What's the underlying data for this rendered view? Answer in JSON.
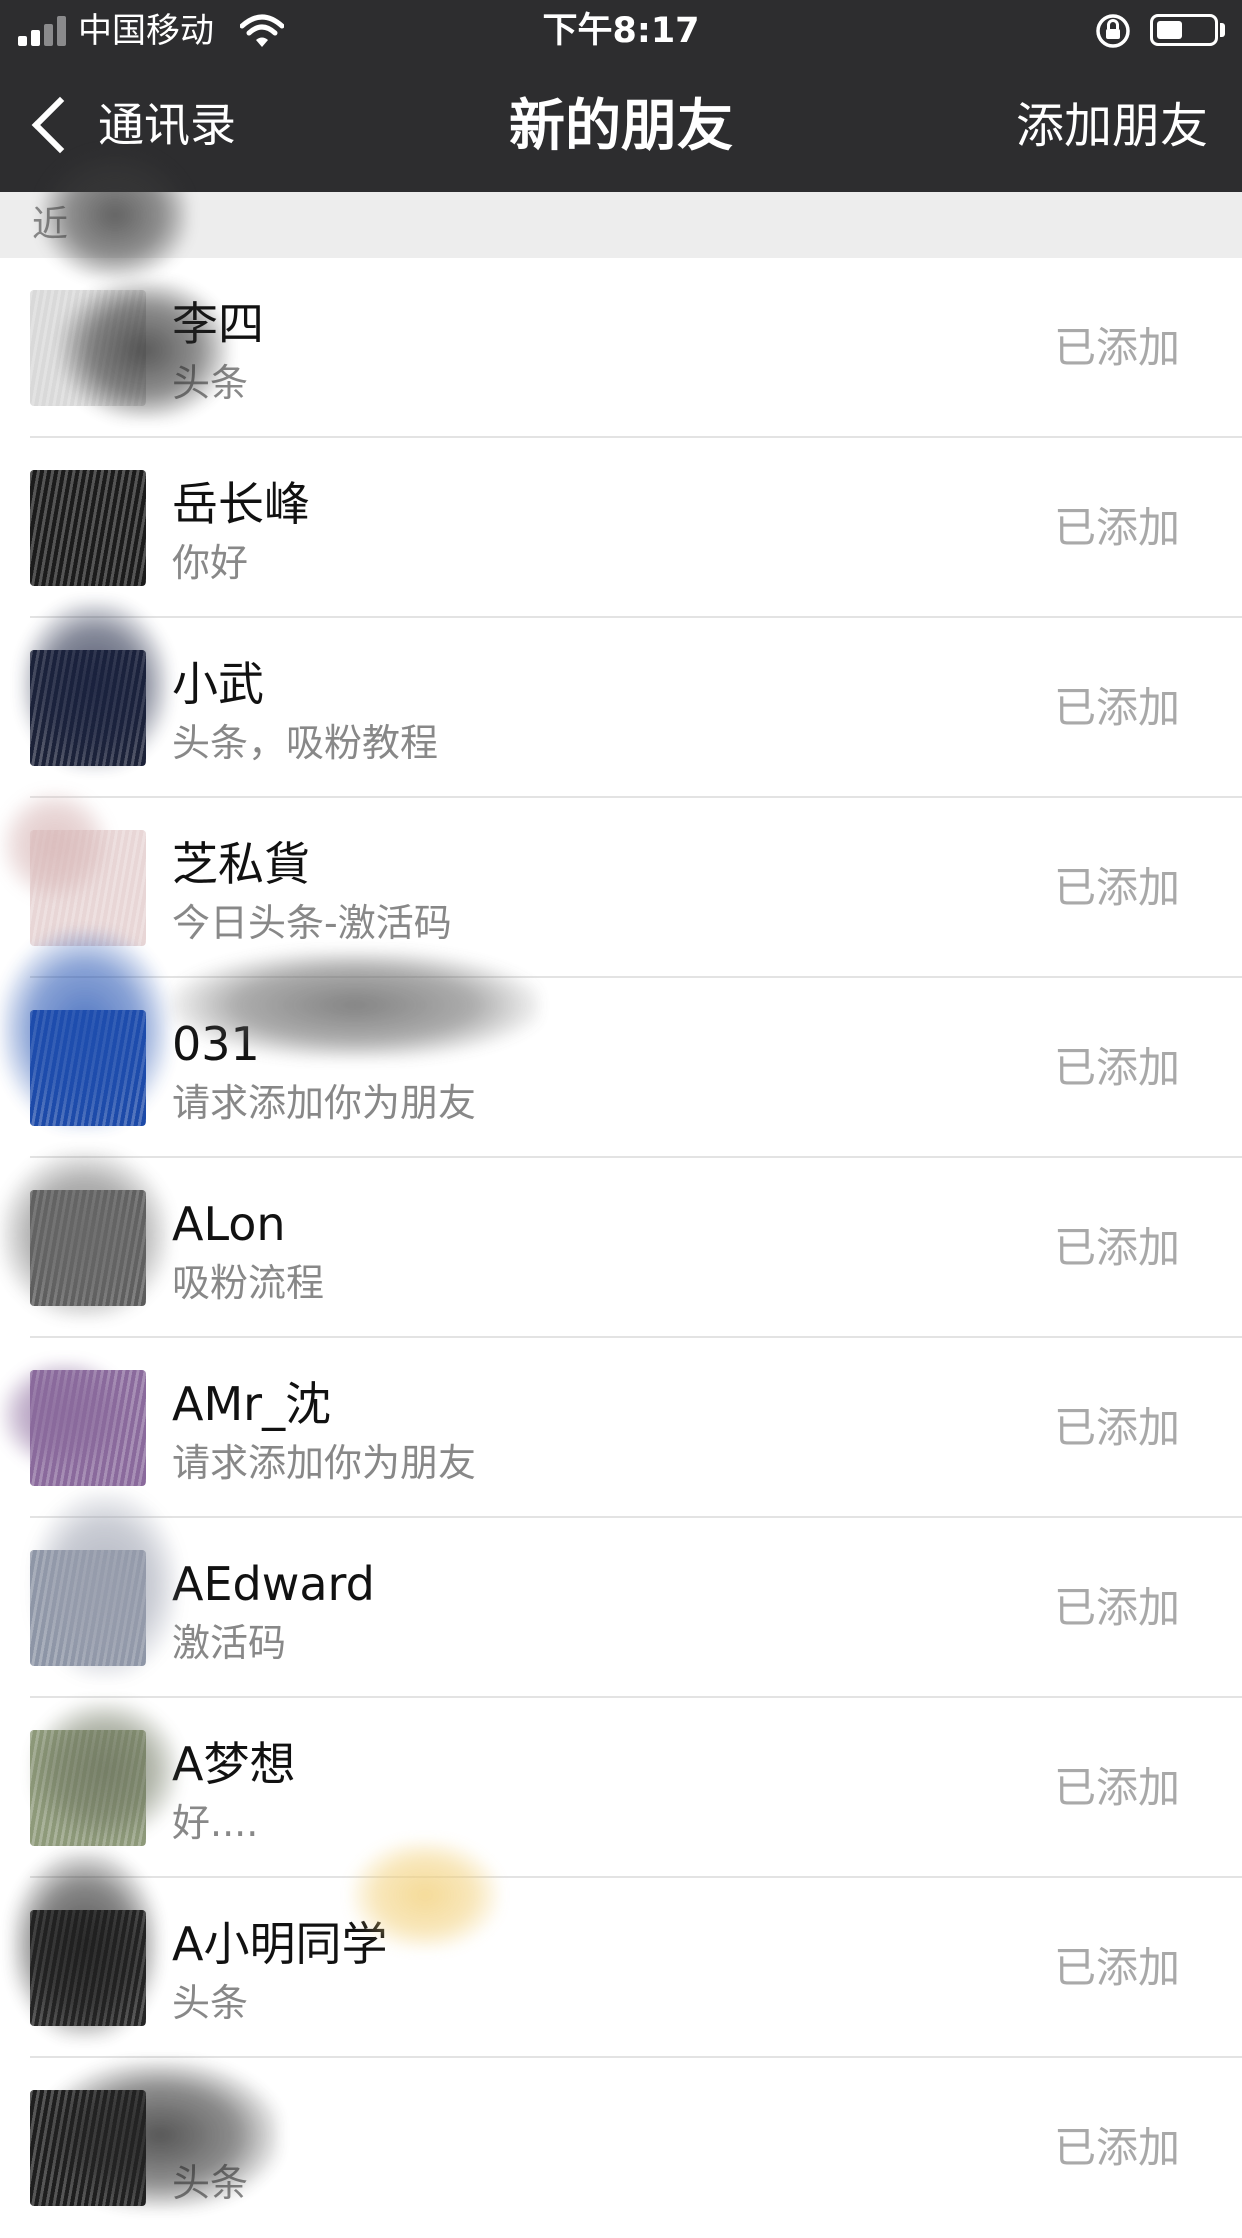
{
  "status_bar": {
    "carrier": "中国移动",
    "time": "下午8:17",
    "battery_level": 0.45
  },
  "nav": {
    "back_label": "通讯录",
    "title": "新的朋友",
    "action_label": "添加朋友"
  },
  "section": {
    "label": "近"
  },
  "requests": [
    {
      "name": "李四",
      "message": "头条",
      "status": "已添加",
      "avatar_color": "#d9d9d9"
    },
    {
      "name": "岳长峰",
      "message": "你好",
      "status": "已添加",
      "avatar_color": "#1b1b1b"
    },
    {
      "name": "小武",
      "message": "头条，吸粉教程",
      "status": "已添加",
      "avatar_color": "#1c2238"
    },
    {
      "name": "芝私貨",
      "message": "今日头条-激活码",
      "status": "已添加",
      "avatar_color": "#e8d6d6"
    },
    {
      "name": "031",
      "message": "请求添加你为朋友",
      "status": "已添加",
      "avatar_color": "#1d4aa8"
    },
    {
      "name": "ALon",
      "message": "吸粉流程",
      "status": "已添加",
      "avatar_color": "#5b5b5b"
    },
    {
      "name": "AMr_沈",
      "message": "请求添加你为朋友",
      "status": "已添加",
      "avatar_color": "#8a6a9c"
    },
    {
      "name": "AEdward",
      "message": "激活码",
      "status": "已添加",
      "avatar_color": "#8d95a6"
    },
    {
      "name": "A梦想",
      "message": "好....",
      "status": "已添加",
      "avatar_color": "#8e9a7a"
    },
    {
      "name": "A小明同学",
      "message": "头条",
      "status": "已添加",
      "avatar_color": "#262626"
    },
    {
      "name": "",
      "message": "头条",
      "status": "已添加",
      "avatar_color": "#1e1e1e"
    }
  ]
}
